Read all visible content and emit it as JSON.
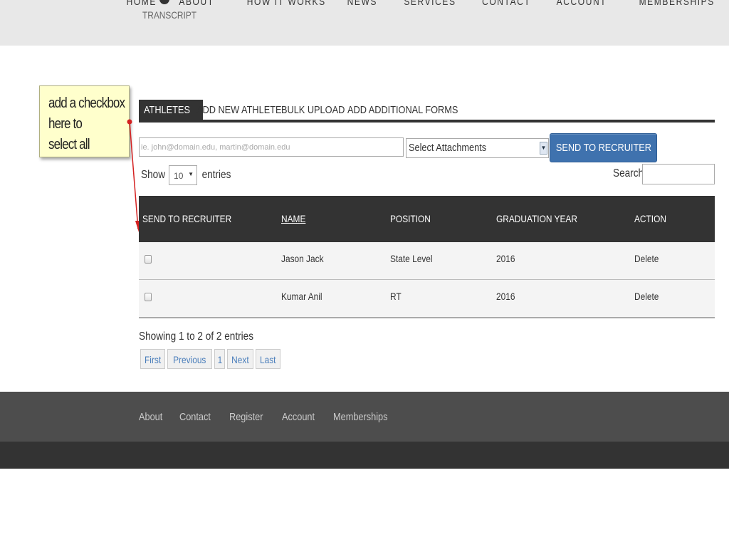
{
  "header": {
    "logo_text": "TRANSCRIPT",
    "nav": [
      "HOME",
      "ABOUT",
      "HOW IT WORKS",
      "NEWS",
      "SERVICES",
      "CONTACT",
      "ACCOUNT",
      "MEMBERSHIPS"
    ]
  },
  "annotation": {
    "lines": [
      "add a checkbox",
      "here to",
      "select all"
    ]
  },
  "tabs": {
    "athletes": "ATHLETES",
    "add_new_athlete": "ADD NEW ATHLETE",
    "bulk_upload": "BULK UPLOAD",
    "add_additional_forms": "ADD ADDITIONAL FORMS"
  },
  "toolbar": {
    "email_placeholder": "ie. john@domain.edu, martin@domain.edu",
    "attachments_selected": "Select Attachments",
    "send_label": "SEND TO RECRUITER"
  },
  "entries": {
    "show_label": "Show",
    "page_size": "10",
    "entries_label": "entries",
    "search_label": "Search:"
  },
  "table": {
    "headers": {
      "send": "SEND TO RECRUITER",
      "name": "NAME",
      "position": "POSITION",
      "grad_year": "GRADUATION YEAR",
      "action": "ACTION"
    },
    "rows": [
      {
        "name": "Jason Jack",
        "position": "State Level",
        "grad_year": "2016",
        "action": "Delete"
      },
      {
        "name": "Kumar Anil",
        "position": "RT",
        "grad_year": "2016",
        "action": "Delete"
      }
    ]
  },
  "info": "Showing 1 to 2 of 2 entries",
  "pagination": {
    "first": "First",
    "previous": "Previous",
    "page": "1",
    "next": "Next",
    "last": "Last"
  },
  "footer": {
    "links": [
      "About",
      "Contact",
      "Register",
      "Account",
      "Memberships"
    ]
  },
  "colors": {
    "header_bg": "#e8e8e8",
    "dark": "#333333",
    "button_blue": "#3f72ae",
    "footer_bg": "#4d4d4d",
    "note_bg": "#ffffcc",
    "arrow_red": "#d42020"
  }
}
